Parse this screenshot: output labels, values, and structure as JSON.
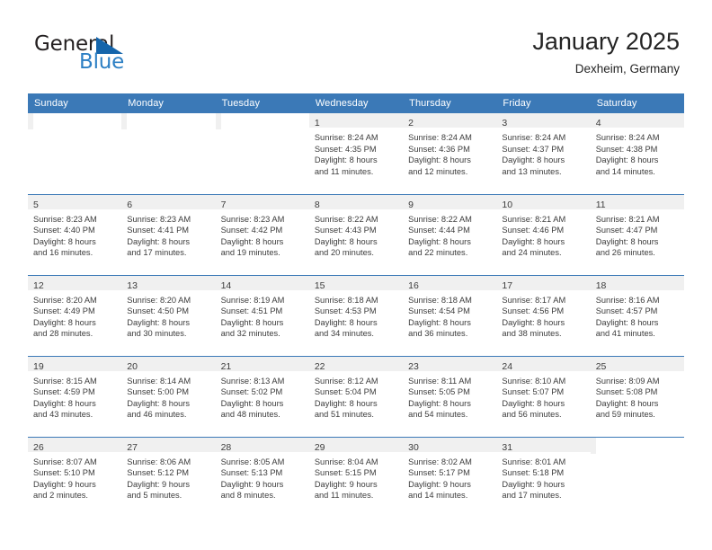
{
  "brand": {
    "name_top": "General",
    "name_bottom": "Blue",
    "flag_icon": "triangle-flag-icon",
    "color_dark": "#231f20",
    "color_blue": "#2c7fc4"
  },
  "header": {
    "title": "January 2025",
    "location": "Dexheim, Germany"
  },
  "theme": {
    "header_blue": "#3b79b7",
    "daynum_band": "#f0f0f0",
    "text": "#3c3c3c"
  },
  "weekdays": [
    "Sunday",
    "Monday",
    "Tuesday",
    "Wednesday",
    "Thursday",
    "Friday",
    "Saturday"
  ],
  "weeks": [
    [
      {
        "empty": true
      },
      {
        "empty": true
      },
      {
        "empty": true
      },
      {
        "day": "1",
        "sunrise": "Sunrise: 8:24 AM",
        "sunset": "Sunset: 4:35 PM",
        "daylight1": "Daylight: 8 hours",
        "daylight2": "and 11 minutes."
      },
      {
        "day": "2",
        "sunrise": "Sunrise: 8:24 AM",
        "sunset": "Sunset: 4:36 PM",
        "daylight1": "Daylight: 8 hours",
        "daylight2": "and 12 minutes."
      },
      {
        "day": "3",
        "sunrise": "Sunrise: 8:24 AM",
        "sunset": "Sunset: 4:37 PM",
        "daylight1": "Daylight: 8 hours",
        "daylight2": "and 13 minutes."
      },
      {
        "day": "4",
        "sunrise": "Sunrise: 8:24 AM",
        "sunset": "Sunset: 4:38 PM",
        "daylight1": "Daylight: 8 hours",
        "daylight2": "and 14 minutes."
      }
    ],
    [
      {
        "day": "5",
        "sunrise": "Sunrise: 8:23 AM",
        "sunset": "Sunset: 4:40 PM",
        "daylight1": "Daylight: 8 hours",
        "daylight2": "and 16 minutes."
      },
      {
        "day": "6",
        "sunrise": "Sunrise: 8:23 AM",
        "sunset": "Sunset: 4:41 PM",
        "daylight1": "Daylight: 8 hours",
        "daylight2": "and 17 minutes."
      },
      {
        "day": "7",
        "sunrise": "Sunrise: 8:23 AM",
        "sunset": "Sunset: 4:42 PM",
        "daylight1": "Daylight: 8 hours",
        "daylight2": "and 19 minutes."
      },
      {
        "day": "8",
        "sunrise": "Sunrise: 8:22 AM",
        "sunset": "Sunset: 4:43 PM",
        "daylight1": "Daylight: 8 hours",
        "daylight2": "and 20 minutes."
      },
      {
        "day": "9",
        "sunrise": "Sunrise: 8:22 AM",
        "sunset": "Sunset: 4:44 PM",
        "daylight1": "Daylight: 8 hours",
        "daylight2": "and 22 minutes."
      },
      {
        "day": "10",
        "sunrise": "Sunrise: 8:21 AM",
        "sunset": "Sunset: 4:46 PM",
        "daylight1": "Daylight: 8 hours",
        "daylight2": "and 24 minutes."
      },
      {
        "day": "11",
        "sunrise": "Sunrise: 8:21 AM",
        "sunset": "Sunset: 4:47 PM",
        "daylight1": "Daylight: 8 hours",
        "daylight2": "and 26 minutes."
      }
    ],
    [
      {
        "day": "12",
        "sunrise": "Sunrise: 8:20 AM",
        "sunset": "Sunset: 4:49 PM",
        "daylight1": "Daylight: 8 hours",
        "daylight2": "and 28 minutes."
      },
      {
        "day": "13",
        "sunrise": "Sunrise: 8:20 AM",
        "sunset": "Sunset: 4:50 PM",
        "daylight1": "Daylight: 8 hours",
        "daylight2": "and 30 minutes."
      },
      {
        "day": "14",
        "sunrise": "Sunrise: 8:19 AM",
        "sunset": "Sunset: 4:51 PM",
        "daylight1": "Daylight: 8 hours",
        "daylight2": "and 32 minutes."
      },
      {
        "day": "15",
        "sunrise": "Sunrise: 8:18 AM",
        "sunset": "Sunset: 4:53 PM",
        "daylight1": "Daylight: 8 hours",
        "daylight2": "and 34 minutes."
      },
      {
        "day": "16",
        "sunrise": "Sunrise: 8:18 AM",
        "sunset": "Sunset: 4:54 PM",
        "daylight1": "Daylight: 8 hours",
        "daylight2": "and 36 minutes."
      },
      {
        "day": "17",
        "sunrise": "Sunrise: 8:17 AM",
        "sunset": "Sunset: 4:56 PM",
        "daylight1": "Daylight: 8 hours",
        "daylight2": "and 38 minutes."
      },
      {
        "day": "18",
        "sunrise": "Sunrise: 8:16 AM",
        "sunset": "Sunset: 4:57 PM",
        "daylight1": "Daylight: 8 hours",
        "daylight2": "and 41 minutes."
      }
    ],
    [
      {
        "day": "19",
        "sunrise": "Sunrise: 8:15 AM",
        "sunset": "Sunset: 4:59 PM",
        "daylight1": "Daylight: 8 hours",
        "daylight2": "and 43 minutes."
      },
      {
        "day": "20",
        "sunrise": "Sunrise: 8:14 AM",
        "sunset": "Sunset: 5:00 PM",
        "daylight1": "Daylight: 8 hours",
        "daylight2": "and 46 minutes."
      },
      {
        "day": "21",
        "sunrise": "Sunrise: 8:13 AM",
        "sunset": "Sunset: 5:02 PM",
        "daylight1": "Daylight: 8 hours",
        "daylight2": "and 48 minutes."
      },
      {
        "day": "22",
        "sunrise": "Sunrise: 8:12 AM",
        "sunset": "Sunset: 5:04 PM",
        "daylight1": "Daylight: 8 hours",
        "daylight2": "and 51 minutes."
      },
      {
        "day": "23",
        "sunrise": "Sunrise: 8:11 AM",
        "sunset": "Sunset: 5:05 PM",
        "daylight1": "Daylight: 8 hours",
        "daylight2": "and 54 minutes."
      },
      {
        "day": "24",
        "sunrise": "Sunrise: 8:10 AM",
        "sunset": "Sunset: 5:07 PM",
        "daylight1": "Daylight: 8 hours",
        "daylight2": "and 56 minutes."
      },
      {
        "day": "25",
        "sunrise": "Sunrise: 8:09 AM",
        "sunset": "Sunset: 5:08 PM",
        "daylight1": "Daylight: 8 hours",
        "daylight2": "and 59 minutes."
      }
    ],
    [
      {
        "day": "26",
        "sunrise": "Sunrise: 8:07 AM",
        "sunset": "Sunset: 5:10 PM",
        "daylight1": "Daylight: 9 hours",
        "daylight2": "and 2 minutes."
      },
      {
        "day": "27",
        "sunrise": "Sunrise: 8:06 AM",
        "sunset": "Sunset: 5:12 PM",
        "daylight1": "Daylight: 9 hours",
        "daylight2": "and 5 minutes."
      },
      {
        "day": "28",
        "sunrise": "Sunrise: 8:05 AM",
        "sunset": "Sunset: 5:13 PM",
        "daylight1": "Daylight: 9 hours",
        "daylight2": "and 8 minutes."
      },
      {
        "day": "29",
        "sunrise": "Sunrise: 8:04 AM",
        "sunset": "Sunset: 5:15 PM",
        "daylight1": "Daylight: 9 hours",
        "daylight2": "and 11 minutes."
      },
      {
        "day": "30",
        "sunrise": "Sunrise: 8:02 AM",
        "sunset": "Sunset: 5:17 PM",
        "daylight1": "Daylight: 9 hours",
        "daylight2": "and 14 minutes."
      },
      {
        "day": "31",
        "sunrise": "Sunrise: 8:01 AM",
        "sunset": "Sunset: 5:18 PM",
        "daylight1": "Daylight: 9 hours",
        "daylight2": "and 17 minutes."
      },
      {
        "empty": true
      }
    ]
  ]
}
